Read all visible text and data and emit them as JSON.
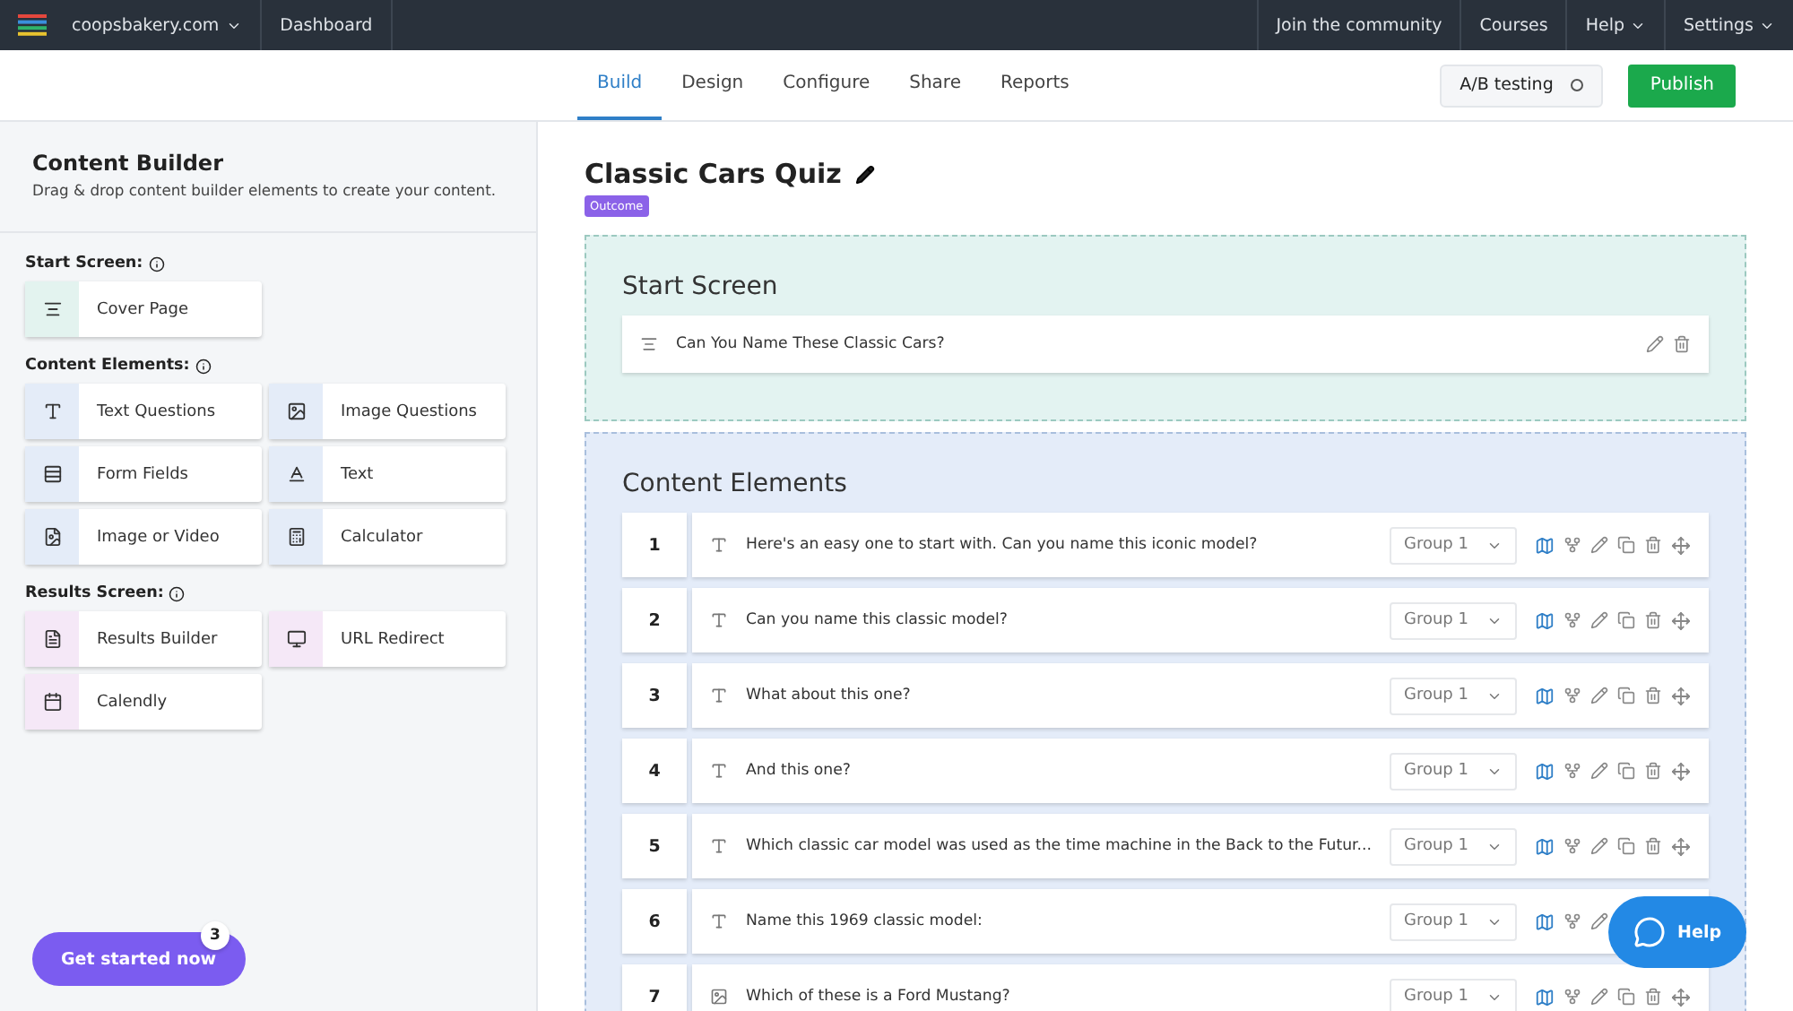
{
  "topbar": {
    "site": "coopsbakery.com",
    "dashboard": "Dashboard",
    "links": [
      {
        "label": "Join the community",
        "dropdown": false
      },
      {
        "label": "Courses",
        "dropdown": false
      },
      {
        "label": "Help",
        "dropdown": true
      },
      {
        "label": "Settings",
        "dropdown": true
      }
    ]
  },
  "tabs": [
    {
      "label": "Build",
      "selected": true
    },
    {
      "label": "Design",
      "selected": false
    },
    {
      "label": "Configure",
      "selected": false
    },
    {
      "label": "Share",
      "selected": false
    },
    {
      "label": "Reports",
      "selected": false
    }
  ],
  "ab_testing": {
    "label": "A/B testing",
    "on": false
  },
  "publish": "Publish",
  "sidebar": {
    "title": "Content Builder",
    "subtitle": "Drag & drop content builder elements to create your content.",
    "sections": [
      {
        "title": "Start Screen:",
        "kind": "start",
        "items": [
          {
            "label": "Cover Page",
            "kind": "cover"
          }
        ]
      },
      {
        "title": "Content Elements:",
        "kind": "content",
        "items": [
          {
            "label": "Text Questions",
            "kind": "text-question"
          },
          {
            "label": "Image Questions",
            "kind": "image-question"
          },
          {
            "label": "Form Fields",
            "kind": "form"
          },
          {
            "label": "Text",
            "kind": "text"
          },
          {
            "label": "Image or Video",
            "kind": "media"
          },
          {
            "label": "Calculator",
            "kind": "calculator"
          }
        ]
      },
      {
        "title": "Results Screen:",
        "kind": "results",
        "items": [
          {
            "label": "Results Builder",
            "kind": "results"
          },
          {
            "label": "URL Redirect",
            "kind": "redirect"
          },
          {
            "label": "Calendly",
            "kind": "calendar"
          }
        ]
      }
    ]
  },
  "get_started": {
    "label": "Get started now",
    "count": "3"
  },
  "quiz": {
    "title": "Classic Cars Quiz",
    "badge": "Outcome"
  },
  "start_screen": {
    "title": "Start Screen",
    "item": "Can You Name These Classic Cars?"
  },
  "content_elements": {
    "title": "Content Elements",
    "rows": [
      {
        "number": "1",
        "kind": "text",
        "text": "Here's an easy one to start with. Can you name this iconic model?",
        "group": "Group 1"
      },
      {
        "number": "2",
        "kind": "text",
        "text": "Can you name this classic model?",
        "group": "Group 1"
      },
      {
        "number": "3",
        "kind": "text",
        "text": "What about this one?",
        "group": "Group 1"
      },
      {
        "number": "4",
        "kind": "text",
        "text": "And this one?",
        "group": "Group 1"
      },
      {
        "number": "5",
        "kind": "text",
        "text": "Which classic car model was used as the time machine in the Back to the Futur...",
        "group": "Group 1"
      },
      {
        "number": "6",
        "kind": "text",
        "text": "Name this 1969 classic model:",
        "group": "Group 1"
      },
      {
        "number": "7",
        "kind": "image",
        "text": "Which of these is a Ford Mustang?",
        "group": "Group 1"
      }
    ]
  },
  "help": "Help"
}
